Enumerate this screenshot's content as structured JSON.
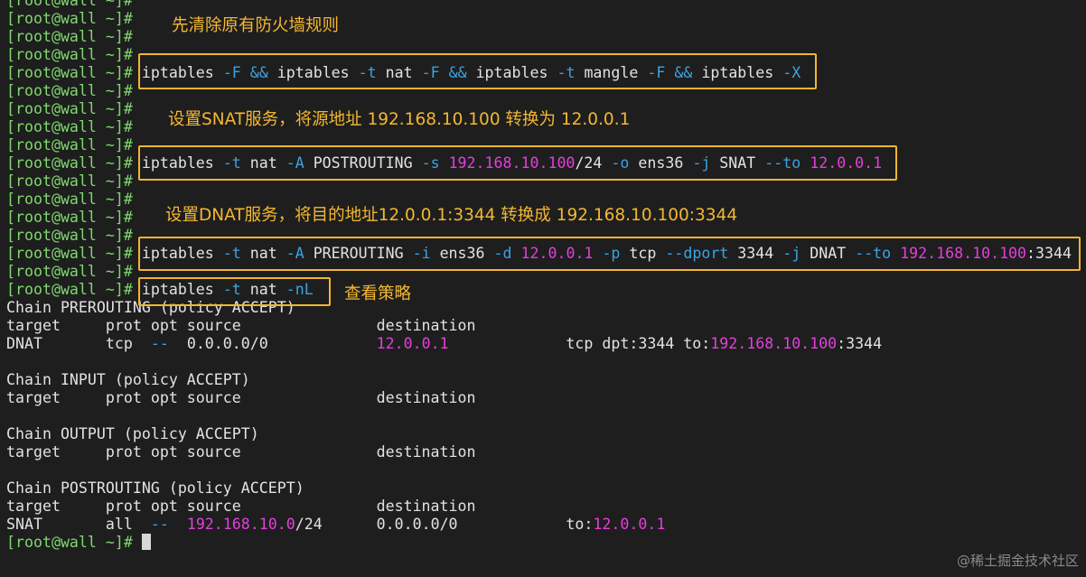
{
  "colors": {
    "background": "#1e1e1e",
    "text": "#e2e2e2",
    "prompt": "#7fd86e",
    "option": "#3ba3e3",
    "ip": "#e43fdc",
    "annotation": "#f2b630"
  },
  "terminal": {
    "lines": [
      {
        "segments": [
          {
            "t": "[root@wall ~]#",
            "c": "prompt"
          }
        ]
      },
      {
        "segments": [
          {
            "t": "[root@wall ~]#",
            "c": "prompt"
          }
        ]
      },
      {
        "segments": [
          {
            "t": "[root@wall ~]#",
            "c": "prompt"
          }
        ]
      },
      {
        "segments": [
          {
            "t": "[root@wall ~]#",
            "c": "prompt"
          }
        ]
      },
      {
        "segments": [
          {
            "t": "[root@wall ~]#",
            "c": "prompt"
          },
          {
            "t": " iptables ",
            "c": "text"
          },
          {
            "t": "-F",
            "c": "option"
          },
          {
            "t": " ",
            "c": "text"
          },
          {
            "t": "&&",
            "c": "option"
          },
          {
            "t": " iptables ",
            "c": "text"
          },
          {
            "t": "-t",
            "c": "option"
          },
          {
            "t": " nat ",
            "c": "text"
          },
          {
            "t": "-F",
            "c": "option"
          },
          {
            "t": " ",
            "c": "text"
          },
          {
            "t": "&&",
            "c": "option"
          },
          {
            "t": " iptables ",
            "c": "text"
          },
          {
            "t": "-t",
            "c": "option"
          },
          {
            "t": " mangle ",
            "c": "text"
          },
          {
            "t": "-F",
            "c": "option"
          },
          {
            "t": " ",
            "c": "text"
          },
          {
            "t": "&&",
            "c": "option"
          },
          {
            "t": " iptables ",
            "c": "text"
          },
          {
            "t": "-X",
            "c": "option"
          }
        ]
      },
      {
        "segments": [
          {
            "t": "[root@wall ~]#",
            "c": "prompt"
          }
        ]
      },
      {
        "segments": [
          {
            "t": "[root@wall ~]#",
            "c": "prompt"
          }
        ]
      },
      {
        "segments": [
          {
            "t": "[root@wall ~]#",
            "c": "prompt"
          }
        ]
      },
      {
        "segments": [
          {
            "t": "[root@wall ~]#",
            "c": "prompt"
          }
        ]
      },
      {
        "segments": [
          {
            "t": "[root@wall ~]#",
            "c": "prompt"
          },
          {
            "t": " iptables ",
            "c": "text"
          },
          {
            "t": "-t",
            "c": "option"
          },
          {
            "t": " nat ",
            "c": "text"
          },
          {
            "t": "-A",
            "c": "option"
          },
          {
            "t": " POSTROUTING ",
            "c": "text"
          },
          {
            "t": "-s",
            "c": "option"
          },
          {
            "t": " ",
            "c": "text"
          },
          {
            "t": "192.168.10.100",
            "c": "ip"
          },
          {
            "t": "/24 ",
            "c": "text"
          },
          {
            "t": "-o",
            "c": "option"
          },
          {
            "t": " ens36 ",
            "c": "text"
          },
          {
            "t": "-j",
            "c": "option"
          },
          {
            "t": " SNAT ",
            "c": "text"
          },
          {
            "t": "--to",
            "c": "option"
          },
          {
            "t": " ",
            "c": "text"
          },
          {
            "t": "12.0.0.1",
            "c": "ip"
          }
        ]
      },
      {
        "segments": [
          {
            "t": "[root@wall ~]#",
            "c": "prompt"
          }
        ]
      },
      {
        "segments": [
          {
            "t": "[root@wall ~]#",
            "c": "prompt"
          }
        ]
      },
      {
        "segments": [
          {
            "t": "[root@wall ~]#",
            "c": "prompt"
          }
        ]
      },
      {
        "segments": [
          {
            "t": "[root@wall ~]#",
            "c": "prompt"
          }
        ]
      },
      {
        "segments": [
          {
            "t": "[root@wall ~]#",
            "c": "prompt"
          },
          {
            "t": " iptables ",
            "c": "text"
          },
          {
            "t": "-t",
            "c": "option"
          },
          {
            "t": " nat ",
            "c": "text"
          },
          {
            "t": "-A",
            "c": "option"
          },
          {
            "t": " PREROUTING ",
            "c": "text"
          },
          {
            "t": "-i",
            "c": "option"
          },
          {
            "t": " ens36 ",
            "c": "text"
          },
          {
            "t": "-d",
            "c": "option"
          },
          {
            "t": " ",
            "c": "text"
          },
          {
            "t": "12.0.0.1",
            "c": "ip"
          },
          {
            "t": " ",
            "c": "text"
          },
          {
            "t": "-p",
            "c": "option"
          },
          {
            "t": " tcp ",
            "c": "text"
          },
          {
            "t": "--dport",
            "c": "option"
          },
          {
            "t": " 3344 ",
            "c": "text"
          },
          {
            "t": "-j",
            "c": "option"
          },
          {
            "t": " DNAT ",
            "c": "text"
          },
          {
            "t": "--to",
            "c": "option"
          },
          {
            "t": " ",
            "c": "text"
          },
          {
            "t": "192.168.10.100",
            "c": "ip"
          },
          {
            "t": ":3344",
            "c": "text"
          }
        ]
      },
      {
        "segments": [
          {
            "t": "[root@wall ~]#",
            "c": "prompt"
          }
        ]
      },
      {
        "segments": [
          {
            "t": "[root@wall ~]#",
            "c": "prompt"
          },
          {
            "t": " iptables ",
            "c": "text"
          },
          {
            "t": "-t",
            "c": "option"
          },
          {
            "t": " nat ",
            "c": "text"
          },
          {
            "t": "-nL",
            "c": "option"
          }
        ]
      },
      {
        "segments": [
          {
            "t": "Chain PREROUTING (policy ACCEPT)",
            "c": "text"
          }
        ]
      },
      {
        "segments": [
          {
            "t": "target     prot opt source               destination",
            "c": "text"
          }
        ]
      },
      {
        "segments": [
          {
            "t": "DNAT       tcp  ",
            "c": "text"
          },
          {
            "t": "--",
            "c": "option"
          },
          {
            "t": "  0.0.0.0/0            ",
            "c": "text"
          },
          {
            "t": "12.0.0.1",
            "c": "ip"
          },
          {
            "t": "             tcp dpt:3344 to:",
            "c": "text"
          },
          {
            "t": "192.168.10.100",
            "c": "ip"
          },
          {
            "t": ":3344",
            "c": "text"
          }
        ]
      },
      {
        "segments": [
          {
            "t": "",
            "c": "text"
          }
        ]
      },
      {
        "segments": [
          {
            "t": "Chain INPUT (policy ACCEPT)",
            "c": "text"
          }
        ]
      },
      {
        "segments": [
          {
            "t": "target     prot opt source               destination",
            "c": "text"
          }
        ]
      },
      {
        "segments": [
          {
            "t": "",
            "c": "text"
          }
        ]
      },
      {
        "segments": [
          {
            "t": "Chain OUTPUT (policy ACCEPT)",
            "c": "text"
          }
        ]
      },
      {
        "segments": [
          {
            "t": "target     prot opt source               destination",
            "c": "text"
          }
        ]
      },
      {
        "segments": [
          {
            "t": "",
            "c": "text"
          }
        ]
      },
      {
        "segments": [
          {
            "t": "Chain POSTROUTING (policy ACCEPT)",
            "c": "text"
          }
        ]
      },
      {
        "segments": [
          {
            "t": "target     prot opt source               destination",
            "c": "text"
          }
        ]
      },
      {
        "segments": [
          {
            "t": "SNAT       all  ",
            "c": "text"
          },
          {
            "t": "--",
            "c": "option"
          },
          {
            "t": "  ",
            "c": "text"
          },
          {
            "t": "192.168.10.0",
            "c": "ip"
          },
          {
            "t": "/24      0.0.0.0/0            to:",
            "c": "text"
          },
          {
            "t": "12.0.0.1",
            "c": "ip"
          }
        ]
      },
      {
        "segments": [
          {
            "t": "[root@wall ~]#",
            "c": "prompt"
          },
          {
            "t": " ",
            "c": "text"
          }
        ],
        "cursor": true
      }
    ]
  },
  "annotations": {
    "clear_rules": "先清除原有防火墙规则",
    "snat_note": "设置SNAT服务，将源地址 192.168.10.100 转换为 12.0.0.1",
    "dnat_note": "设置DNAT服务，将目的地址12.0.0.1:3344 转换成 192.168.10.100:3344",
    "view_policy": "查看策略"
  },
  "watermark": "@稀土掘金技术社区"
}
